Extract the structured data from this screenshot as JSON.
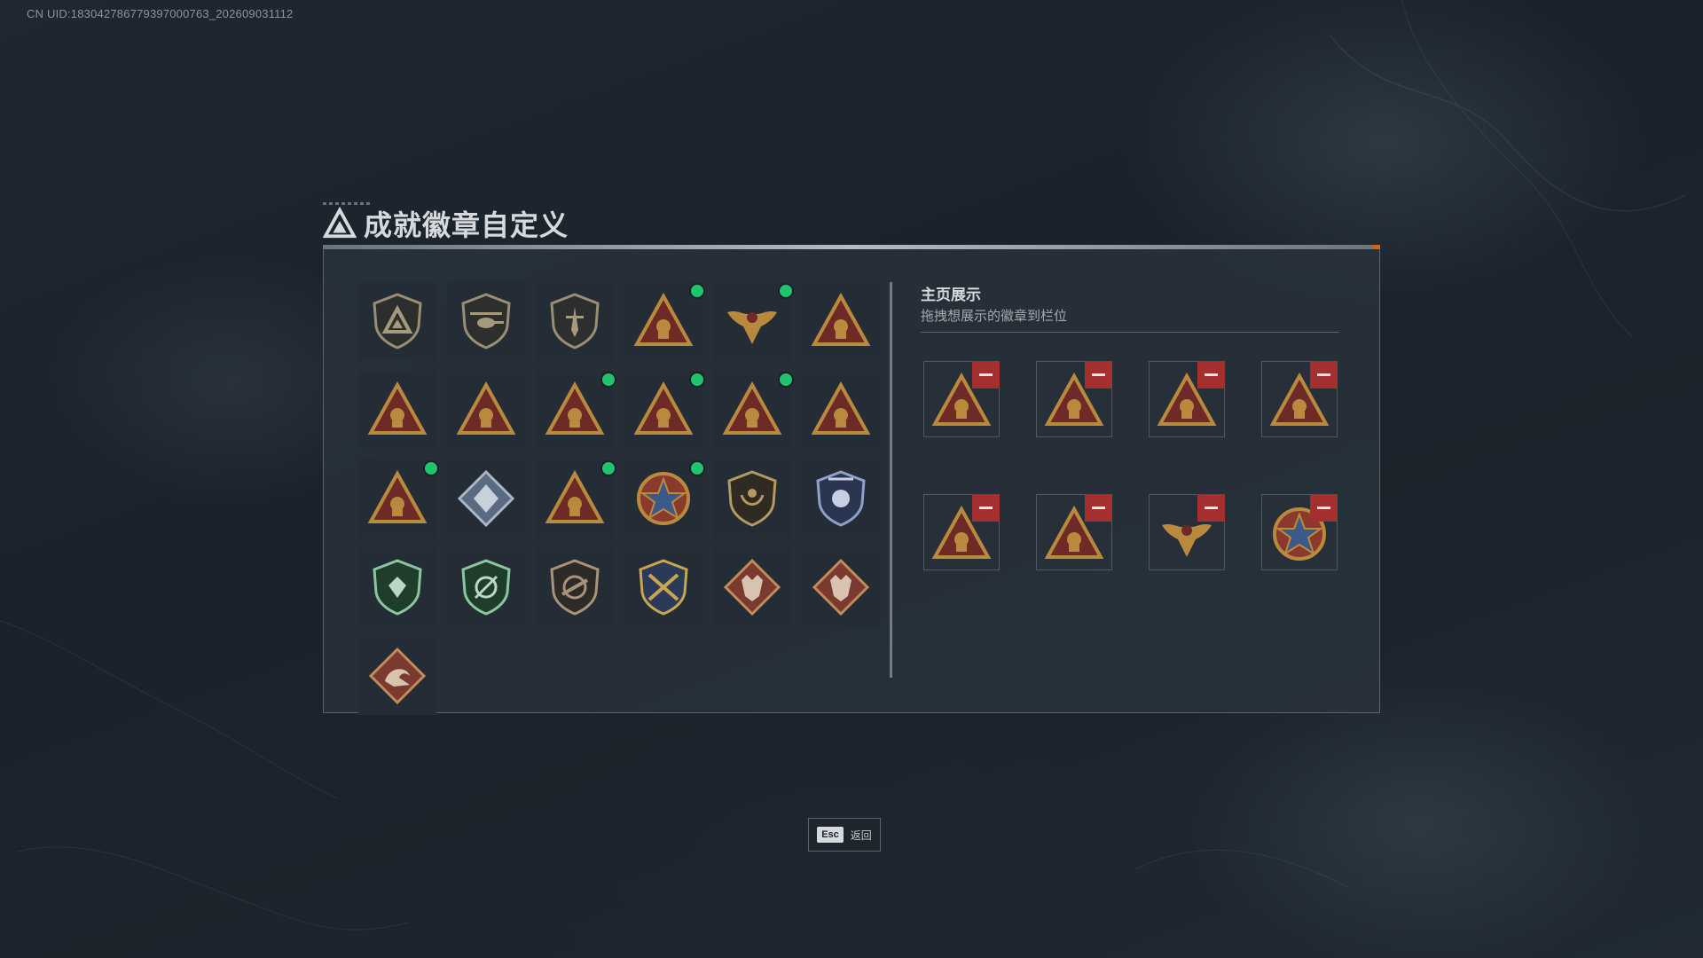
{
  "uid_text": "CN UID:183042786779397000763_202609031112",
  "title": "成就徽章自定义",
  "showcase": {
    "title": "主页展示",
    "subtitle": "拖拽想展示的徽章到栏位"
  },
  "footer": {
    "esc_key": "Esc",
    "esc_label": "返回"
  },
  "colors": {
    "accent_new_dot": "#1fc46c",
    "remove_button": "#a42f2f",
    "badge_gold": "#b98a3e",
    "badge_red": "#6e2a26"
  },
  "badges": [
    {
      "icon": "delta-triangle-shield-badge-icon",
      "new": false
    },
    {
      "icon": "helicopter-shield-badge-icon",
      "new": false
    },
    {
      "icon": "dagger-shield-badge-icon",
      "new": false
    },
    {
      "icon": "drone-x-triangle-badge-icon",
      "new": true
    },
    {
      "icon": "eagle-emblem-badge-icon",
      "new": true
    },
    {
      "icon": "hand-gesture-triangle-badge-icon",
      "new": false
    },
    {
      "icon": "nest-triangle-badge-icon",
      "new": false
    },
    {
      "icon": "number-one-triangle-badge-icon",
      "new": false
    },
    {
      "icon": "supply-box-triangle-badge-icon",
      "new": true
    },
    {
      "icon": "soldier-triangle-badge-icon",
      "new": true
    },
    {
      "icon": "wolf-triangle-badge-icon",
      "new": true
    },
    {
      "icon": "squad-triangle-badge-icon",
      "new": false
    },
    {
      "icon": "rocket-triangle-badge-icon",
      "new": true
    },
    {
      "icon": "crystal-diamond-badge-icon",
      "new": false
    },
    {
      "icon": "gunner-triangle-badge-icon",
      "new": true
    },
    {
      "icon": "star-medal-badge-icon",
      "new": true
    },
    {
      "icon": "wreath-shield-badge-icon",
      "new": false
    },
    {
      "icon": "police-blue-shield-badge-icon",
      "new": false
    },
    {
      "icon": "green-gem-shield-badge-icon",
      "new": false
    },
    {
      "icon": "crosshair-green-shield-badge-icon",
      "new": false
    },
    {
      "icon": "rifle-shield-badge-icon",
      "new": false
    },
    {
      "icon": "crossed-rifles-gold-badge-icon",
      "new": false
    },
    {
      "icon": "wolf-diamond-badge-icon",
      "new": false
    },
    {
      "icon": "wolf-red-diamond-badge-icon",
      "new": false
    },
    {
      "icon": "dragon-diamond-badge-icon",
      "new": false
    }
  ],
  "showcase_slots": [
    {
      "icon": "drone-x-triangle-badge-icon"
    },
    {
      "icon": "supply-box-triangle-badge-icon"
    },
    {
      "icon": "rocket-triangle-badge-icon"
    },
    {
      "icon": "wolf-triangle-badge-icon"
    },
    {
      "icon": "soldier-triangle-badge-icon"
    },
    {
      "icon": "gunner-triangle-badge-icon"
    },
    {
      "icon": "eagle-emblem-badge-icon"
    },
    {
      "icon": "star-medal-badge-icon"
    }
  ]
}
